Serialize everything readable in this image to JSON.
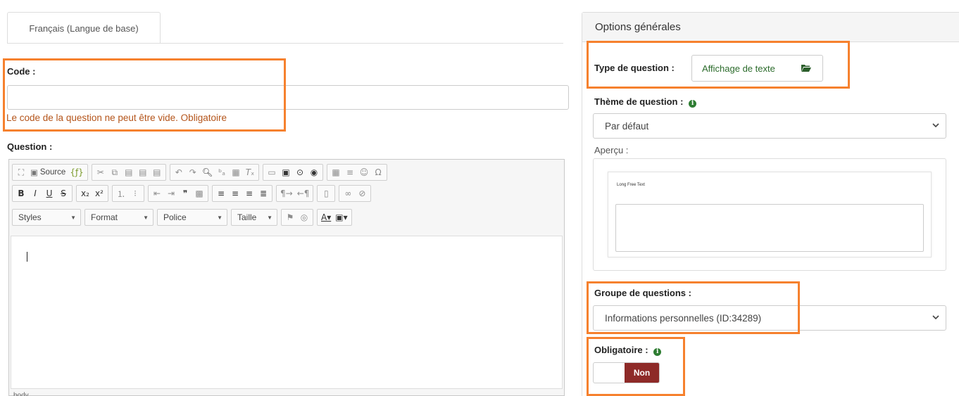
{
  "tabs": [
    {
      "label": "Français (Langue de base)"
    }
  ],
  "code": {
    "label": "Code :",
    "value": "",
    "error": "Le code de la question ne peut être vide. Obligatoire"
  },
  "question": {
    "label": "Question :"
  },
  "editor": {
    "source_label": "Source",
    "styles_label": "Styles",
    "format_label": "Format",
    "font_label": "Police",
    "size_label": "Taille",
    "status_path": "body"
  },
  "options": {
    "header": "Options générales",
    "question_type": {
      "label": "Type de question :",
      "value": "Affichage de texte",
      "icon": "folder-open-icon"
    },
    "question_theme": {
      "label": "Thème de question :",
      "value": "Par défaut"
    },
    "preview": {
      "label": "Aperçu :",
      "sample_label": "Long Free Text"
    },
    "question_group": {
      "label": "Groupe de questions :",
      "value": "Informations personnelles (ID:34289)"
    },
    "mandatory": {
      "label": "Obligatoire :",
      "toggle_value": "Non"
    }
  },
  "colors": {
    "highlight": "#f6812e",
    "error_text": "#b4541a",
    "toggle_active": "#8e2a28",
    "info_icon": "#2e7d32",
    "question_type_text": "#2b6b2b"
  }
}
